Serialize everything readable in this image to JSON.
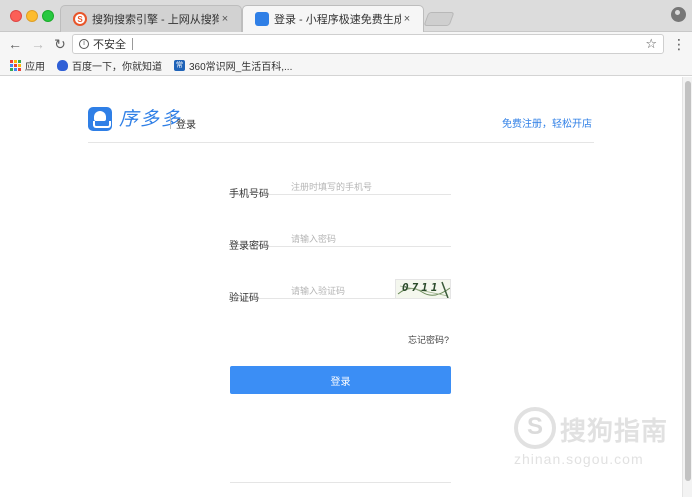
{
  "browser": {
    "tabs": [
      {
        "title": "搜狗搜索引擎 - 上网从搜狗开始",
        "favicon": "sogou-icon",
        "active": false
      },
      {
        "title": "登录 - 小程序极速免费生成",
        "favicon": "app-logo-icon",
        "active": true
      }
    ],
    "close_glyph": "×",
    "address": {
      "security_label": "不安全",
      "url": ""
    },
    "bookmarks": [
      {
        "label": "应用",
        "icon": "apps-grid-icon"
      },
      {
        "label": "百度一下，你就知道",
        "icon": "baidu-paw-icon"
      },
      {
        "label": "360常识网_生活百科,...",
        "icon": "site-icon"
      }
    ]
  },
  "page": {
    "logo_text": "序多多",
    "page_label": "登录",
    "register_link": "免费注册，轻松开店",
    "form": {
      "phone": {
        "label": "手机号码",
        "placeholder": "注册时填写的手机号",
        "value": ""
      },
      "password": {
        "label": "登录密码",
        "placeholder": "请输入密码",
        "value": ""
      },
      "captcha": {
        "label": "验证码",
        "placeholder": "请输入验证码",
        "value": "",
        "image_text": "0711"
      }
    },
    "forgot_link": "忘记密码?",
    "login_button": "登录"
  },
  "watermark": {
    "text": "搜狗指南",
    "url": "zhinan.sogou.com"
  },
  "colors": {
    "accent": "#3b8ef5",
    "brand": "#2f7fe6",
    "link": "#2f7fe6"
  }
}
